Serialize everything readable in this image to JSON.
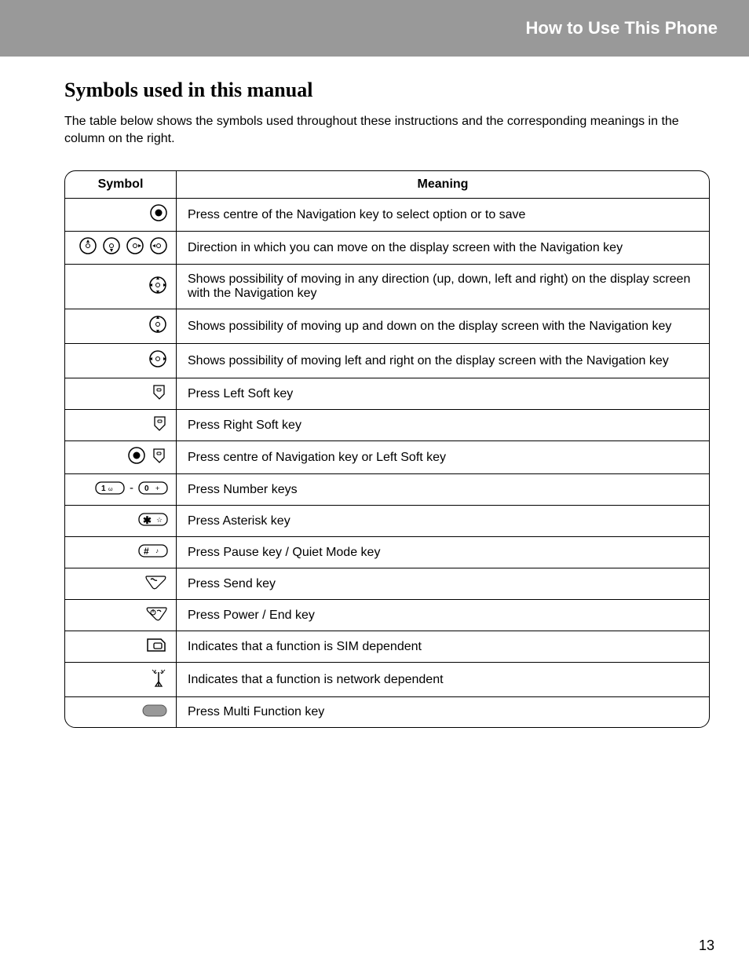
{
  "header": {
    "title": "How to Use This Phone"
  },
  "section": {
    "title": "Symbols used in this manual",
    "intro": "The table below shows the symbols used throughout these instructions and the corresponding meanings in the column on the right."
  },
  "columns": {
    "symbol": "Symbol",
    "meaning": "Meaning"
  },
  "rows": [
    {
      "icon": "nav-centre",
      "meaning": "Press centre of the Navigation key to select option or to save"
    },
    {
      "icon": "nav-directions",
      "meaning": "Direction in which you can move on the display screen with the Navigation key"
    },
    {
      "icon": "nav-all",
      "meaning": "Shows possibility of moving in any direction (up, down, left and right) on the display screen with the Navigation key"
    },
    {
      "icon": "nav-updown",
      "meaning": "Shows possibility of moving up and down on the display screen with the Navigation key"
    },
    {
      "icon": "nav-leftright",
      "meaning": "Shows possibility of moving left and right on the display screen with the Navigation key"
    },
    {
      "icon": "left-soft",
      "meaning": "Press Left Soft key"
    },
    {
      "icon": "right-soft",
      "meaning": "Press Right Soft key"
    },
    {
      "icon": "centre-or-left-soft",
      "meaning": "Press centre of Navigation key or Left Soft key"
    },
    {
      "icon": "number-keys",
      "meaning": "Press Number keys"
    },
    {
      "icon": "asterisk",
      "meaning": "Press Asterisk key"
    },
    {
      "icon": "hash",
      "meaning": "Press Pause key / Quiet Mode key"
    },
    {
      "icon": "send",
      "meaning": "Press Send key"
    },
    {
      "icon": "end",
      "meaning": "Press Power / End key"
    },
    {
      "icon": "sim",
      "meaning": "Indicates that a function is SIM dependent"
    },
    {
      "icon": "network",
      "meaning": "Indicates that a function is network dependent"
    },
    {
      "icon": "multi",
      "meaning": "Press Multi Function key"
    }
  ],
  "page_number": "13"
}
